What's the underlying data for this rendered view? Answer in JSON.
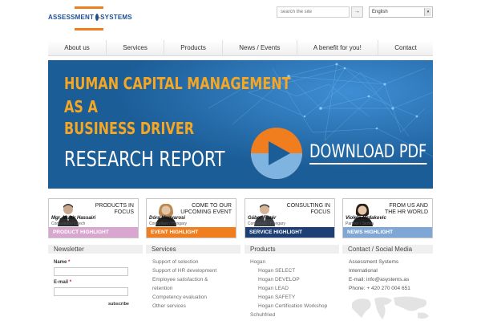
{
  "brand": {
    "logo_word_left": "ASSESSMENT",
    "logo_word_right": "SYSTEMS",
    "accent_color": "#f07d1e",
    "brand_color": "#1d4f91"
  },
  "header": {
    "search_placeholder": "search the site",
    "search_button_glyph": "→",
    "language": "English",
    "dropdown_glyph": "▾"
  },
  "nav": {
    "items": [
      {
        "label": "About us"
      },
      {
        "label": "Services"
      },
      {
        "label": "Products"
      },
      {
        "label": "News / Events"
      },
      {
        "label": "A benefit for you!"
      },
      {
        "label": "Contact"
      }
    ]
  },
  "banner": {
    "line1": "HUMAN CAPITAL MANAGEMENT",
    "line2": "AS A",
    "line3": "BUSINESS DRIVER",
    "line4": "RESEARCH REPORT",
    "cta": "DOWNLOAD PDF",
    "background_color": "#1b5d97",
    "headline_color": "#f5a623"
  },
  "highlights": [
    {
      "title": "PRODUCTS IN FOCUS",
      "name": "Mgr. Munir Hassairi",
      "role": "Consultant / Czech",
      "bar": "PRODUCT HIGHLIGHT",
      "bar_color": "#d9a6cf",
      "gender": "male"
    },
    {
      "title": "COME TO OUR UPCOMING EVENT",
      "name": "Dóra Magyarosi",
      "role": "Consultant / Hungary",
      "bar": "EVENT HIGHLIGHT",
      "bar_color": "#f07d1e",
      "gender": "female"
    },
    {
      "title": "CONSULTING IN FOCUS",
      "name": "Gábor Füzér",
      "role": "Consultant / Hungary",
      "bar": "SERVICE HIGHLIGHT",
      "bar_color": "#1d3f73",
      "gender": "male"
    },
    {
      "title": "FROM US AND THE HR WORLD",
      "name": "Violeta Mrdakovic",
      "role": "Partner / Serbia",
      "bar": "NEWS HIGHLIGHT",
      "bar_color": "#7fa7d6",
      "gender": "female"
    }
  ],
  "newsletter": {
    "heading": "Newsletter",
    "name_label": "Name",
    "email_label": "E-mail",
    "required_mark": "*",
    "subscribe": "subscribe"
  },
  "services": {
    "heading": "Services",
    "items": [
      "Support of selection",
      "Support of HR development",
      "Employee satisfaction &",
      "retention",
      "Competency evaluation",
      "Other services"
    ]
  },
  "products": {
    "heading": "Products",
    "items": [
      {
        "label": "Hogan",
        "indent": false
      },
      {
        "label": "Hogan SELECT",
        "indent": true
      },
      {
        "label": "Hogan DEVELOP",
        "indent": true
      },
      {
        "label": "Hogan LEAD",
        "indent": true
      },
      {
        "label": "Hogan SAFETY",
        "indent": true
      },
      {
        "label": "Hogan Certification Workshop",
        "indent": true
      },
      {
        "label": "Schuhfried",
        "indent": false
      }
    ]
  },
  "contact": {
    "heading": "Contact / Social Media",
    "company_line1": "Assessment Systems",
    "company_line2": "International",
    "email": "E-mail: info@asystems.as",
    "phone": "Phone: + 420 270 004 651"
  }
}
